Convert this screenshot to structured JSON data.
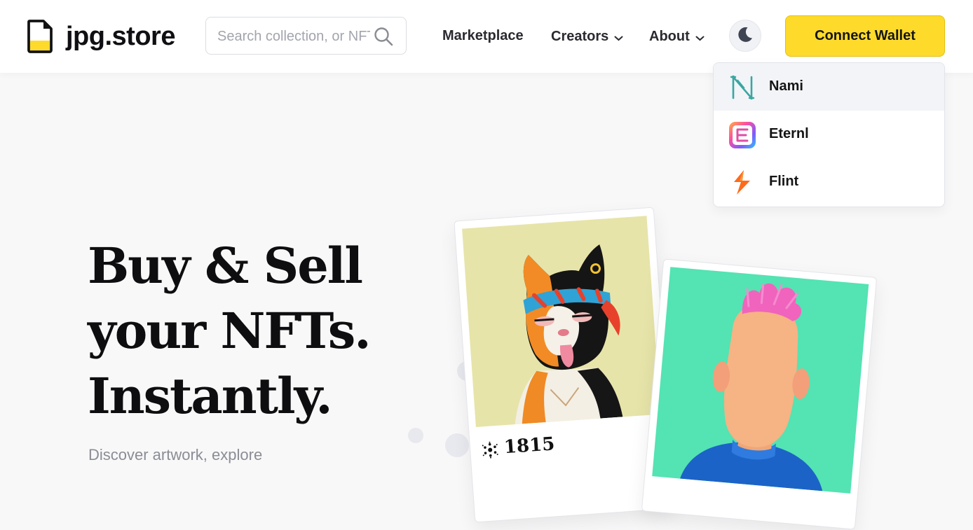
{
  "header": {
    "logo_text": "jpg.store",
    "search": {
      "placeholder": "Search collection, or NFT",
      "value": ""
    },
    "nav": [
      {
        "label": "Marketplace",
        "has_dropdown": false
      },
      {
        "label": "Creators",
        "has_dropdown": true
      },
      {
        "label": "About",
        "has_dropdown": true
      }
    ],
    "theme_icon": "moon-icon",
    "connect_button_label": "Connect Wallet",
    "accent_color": "#fedb2b"
  },
  "wallet_menu": {
    "items": [
      {
        "label": "Nami",
        "icon": "nami-wallet-icon",
        "highlighted": true
      },
      {
        "label": "Eternl",
        "icon": "eternl-wallet-icon",
        "highlighted": false
      },
      {
        "label": "Flint",
        "icon": "flint-wallet-icon",
        "highlighted": false
      }
    ]
  },
  "hero": {
    "title_lines": [
      "Buy & Sell",
      "your NFTs.",
      "Instantly."
    ],
    "subtitle": "Discover artwork, explore"
  },
  "cards": [
    {
      "id_label": "1815",
      "currency_icon": "cardano-icon",
      "art": "cat-nft-image"
    },
    {
      "art": "pink-hair-character-nft-image"
    }
  ]
}
